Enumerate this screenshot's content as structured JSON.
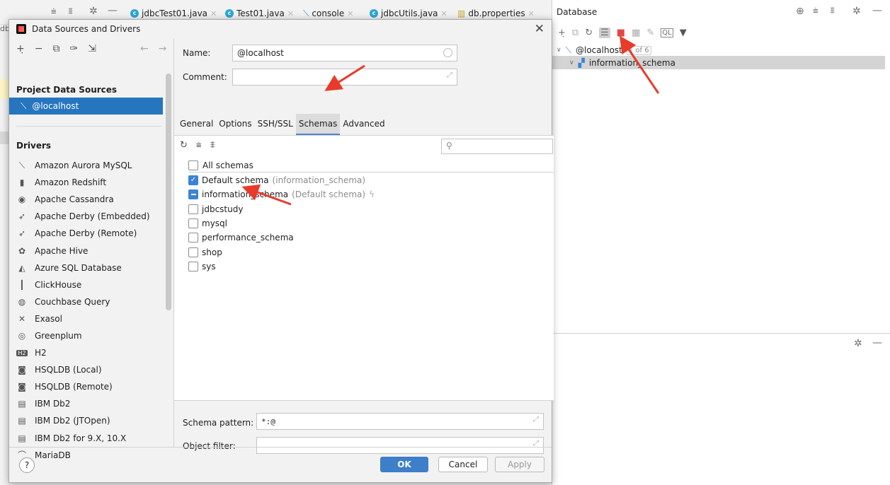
{
  "ide_tabs": [
    "jdbcTest01.java",
    "Test01.java",
    "console",
    "jdbcUtils.java",
    "db.properties"
  ],
  "ide_partial_left_text": "db",
  "database_panel": {
    "title": "Database",
    "tree_root": "@localhost",
    "tree_root_badge": "1 of 6",
    "tree_child": "information_schema"
  },
  "dialog": {
    "title": "Data Sources and Drivers",
    "close_glyph": "✕",
    "project_section": "Project Data Sources",
    "selected_source": "@localhost",
    "drivers_section": "Drivers",
    "drivers": [
      {
        "icon": "aurora-icon",
        "glyph": "⟍",
        "label": "Amazon Aurora MySQL"
      },
      {
        "icon": "redshift-icon",
        "glyph": "▮",
        "label": "Amazon Redshift"
      },
      {
        "icon": "cassandra-icon",
        "glyph": "◉",
        "label": "Apache Cassandra"
      },
      {
        "icon": "derby-icon",
        "glyph": "➶",
        "label": "Apache Derby (Embedded)"
      },
      {
        "icon": "derby-icon",
        "glyph": "➶",
        "label": "Apache Derby (Remote)"
      },
      {
        "icon": "hive-icon",
        "glyph": "✿",
        "label": "Apache Hive"
      },
      {
        "icon": "azure-icon",
        "glyph": "◭",
        "label": "Azure SQL Database"
      },
      {
        "icon": "clickhouse-icon",
        "glyph": "┃",
        "label": "ClickHouse"
      },
      {
        "icon": "couchbase-icon",
        "glyph": "◍",
        "label": "Couchbase Query"
      },
      {
        "icon": "exasol-icon",
        "glyph": "✕",
        "label": "Exasol"
      },
      {
        "icon": "greenplum-icon",
        "glyph": "◎",
        "label": "Greenplum"
      },
      {
        "icon": "h2-icon",
        "glyph": "H2",
        "label": "H2"
      },
      {
        "icon": "hsqldb-icon",
        "glyph": "◙",
        "label": "HSQLDB (Local)"
      },
      {
        "icon": "hsqldb-icon",
        "glyph": "◙",
        "label": "HSQLDB (Remote)"
      },
      {
        "icon": "ibm-icon",
        "glyph": "▤",
        "label": "IBM Db2"
      },
      {
        "icon": "ibm-icon",
        "glyph": "▤",
        "label": "IBM Db2 (JTOpen)"
      },
      {
        "icon": "ibm-icon",
        "glyph": "▤",
        "label": "IBM Db2 for 9.X, 10.X"
      },
      {
        "icon": "mariadb-icon",
        "glyph": "⌒",
        "label": "MariaDB"
      }
    ],
    "form": {
      "name_label": "Name:",
      "name_value": "@localhost",
      "comment_label": "Comment:",
      "comment_value": ""
    },
    "tabs": [
      "General",
      "Options",
      "SSH/SSL",
      "Schemas",
      "Advanced"
    ],
    "active_tab": "Schemas",
    "all_schemas_label": "All schemas",
    "schemas": [
      {
        "name": "Default schema",
        "hint": "(information_schema)",
        "state": "checked",
        "bolt": false
      },
      {
        "name": "information_schema",
        "hint": "(Default schema)",
        "state": "partial",
        "bolt": true
      },
      {
        "name": "jdbcstudy",
        "hint": "",
        "state": "unchecked",
        "bolt": false
      },
      {
        "name": "mysql",
        "hint": "",
        "state": "unchecked",
        "bolt": false
      },
      {
        "name": "performance_schema",
        "hint": "",
        "state": "unchecked",
        "bolt": false
      },
      {
        "name": "shop",
        "hint": "",
        "state": "unchecked",
        "bolt": false
      },
      {
        "name": "sys",
        "hint": "",
        "state": "unchecked",
        "bolt": false
      }
    ],
    "schema_pattern_label": "Schema pattern:",
    "schema_pattern_value": "*:@",
    "object_filter_label": "Object filter:",
    "object_filter_value": "",
    "buttons": {
      "ok": "OK",
      "cancel": "Cancel",
      "apply": "Apply",
      "help": "?"
    }
  },
  "colors": {
    "selection": "#2675bf",
    "ok_button": "#3d7fc9",
    "annotation_arrow": "#e83b2a"
  }
}
